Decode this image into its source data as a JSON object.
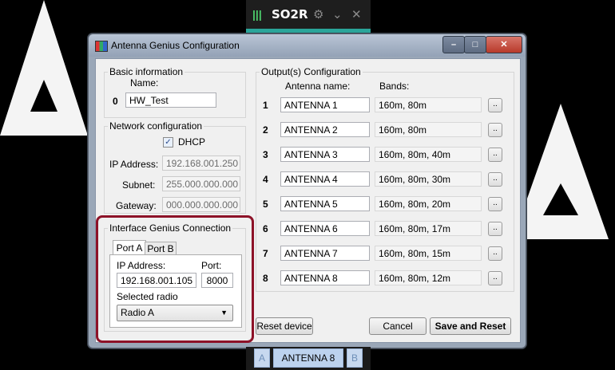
{
  "topbar": {
    "title": "SO2R",
    "logo_icon": "waveform-icon",
    "gear_icon": "gear-icon",
    "chevron_icon": "chevron-down-icon",
    "close_icon": "close-icon",
    "accent_color": "#2aa59a"
  },
  "window": {
    "title": "Antenna Genius Configuration"
  },
  "basic": {
    "label": "Basic information",
    "name_label": "Name:",
    "index": "0",
    "name_value": "HW_Test"
  },
  "network": {
    "label": "Network configuration",
    "dhcp_label": "DHCP",
    "dhcp_checked": true,
    "ip_label": "IP Address:",
    "ip_value": "192.168.001.250",
    "subnet_label": "Subnet:",
    "subnet_value": "255.000.000.000",
    "gateway_label": "Gateway:",
    "gateway_value": "000.000.000.000"
  },
  "igc": {
    "label": "Interface Genius Connection",
    "tabs": [
      "Port A",
      "Port B"
    ],
    "ip_label": "IP Address:",
    "ip_value": "192.168.001.105",
    "port_label": "Port:",
    "port_value": "8000",
    "radio_label": "Selected radio",
    "radio_value": "Radio A",
    "highlight_color": "#8d1228"
  },
  "outputs": {
    "label": "Output(s) Configuration",
    "col_antenna": "Antenna name:",
    "col_bands": "Bands:",
    "rows": [
      {
        "num": "1",
        "antenna": "ANTENNA 1",
        "bands": "160m, 80m",
        "btn": ".."
      },
      {
        "num": "2",
        "antenna": "ANTENNA 2",
        "bands": "160m, 80m",
        "btn": ".."
      },
      {
        "num": "3",
        "antenna": "ANTENNA 3",
        "bands": "160m, 80m, 40m",
        "btn": ".."
      },
      {
        "num": "4",
        "antenna": "ANTENNA 4",
        "bands": "160m, 80m, 30m",
        "btn": ".."
      },
      {
        "num": "5",
        "antenna": "ANTENNA 5",
        "bands": "160m, 80m, 20m",
        "btn": ".."
      },
      {
        "num": "6",
        "antenna": "ANTENNA 6",
        "bands": "160m, 80m, 17m",
        "btn": ".."
      },
      {
        "num": "7",
        "antenna": "ANTENNA 7",
        "bands": "160m, 80m, 15m",
        "btn": ".."
      },
      {
        "num": "8",
        "antenna": "ANTENNA 8",
        "bands": "160m, 80m, 12m",
        "btn": ".."
      }
    ]
  },
  "buttons": {
    "reset": "Reset device",
    "cancel": "Cancel",
    "save": "Save and Reset"
  },
  "bottom": {
    "a": "A",
    "antenna": "ANTENNA 8",
    "b": "B"
  }
}
